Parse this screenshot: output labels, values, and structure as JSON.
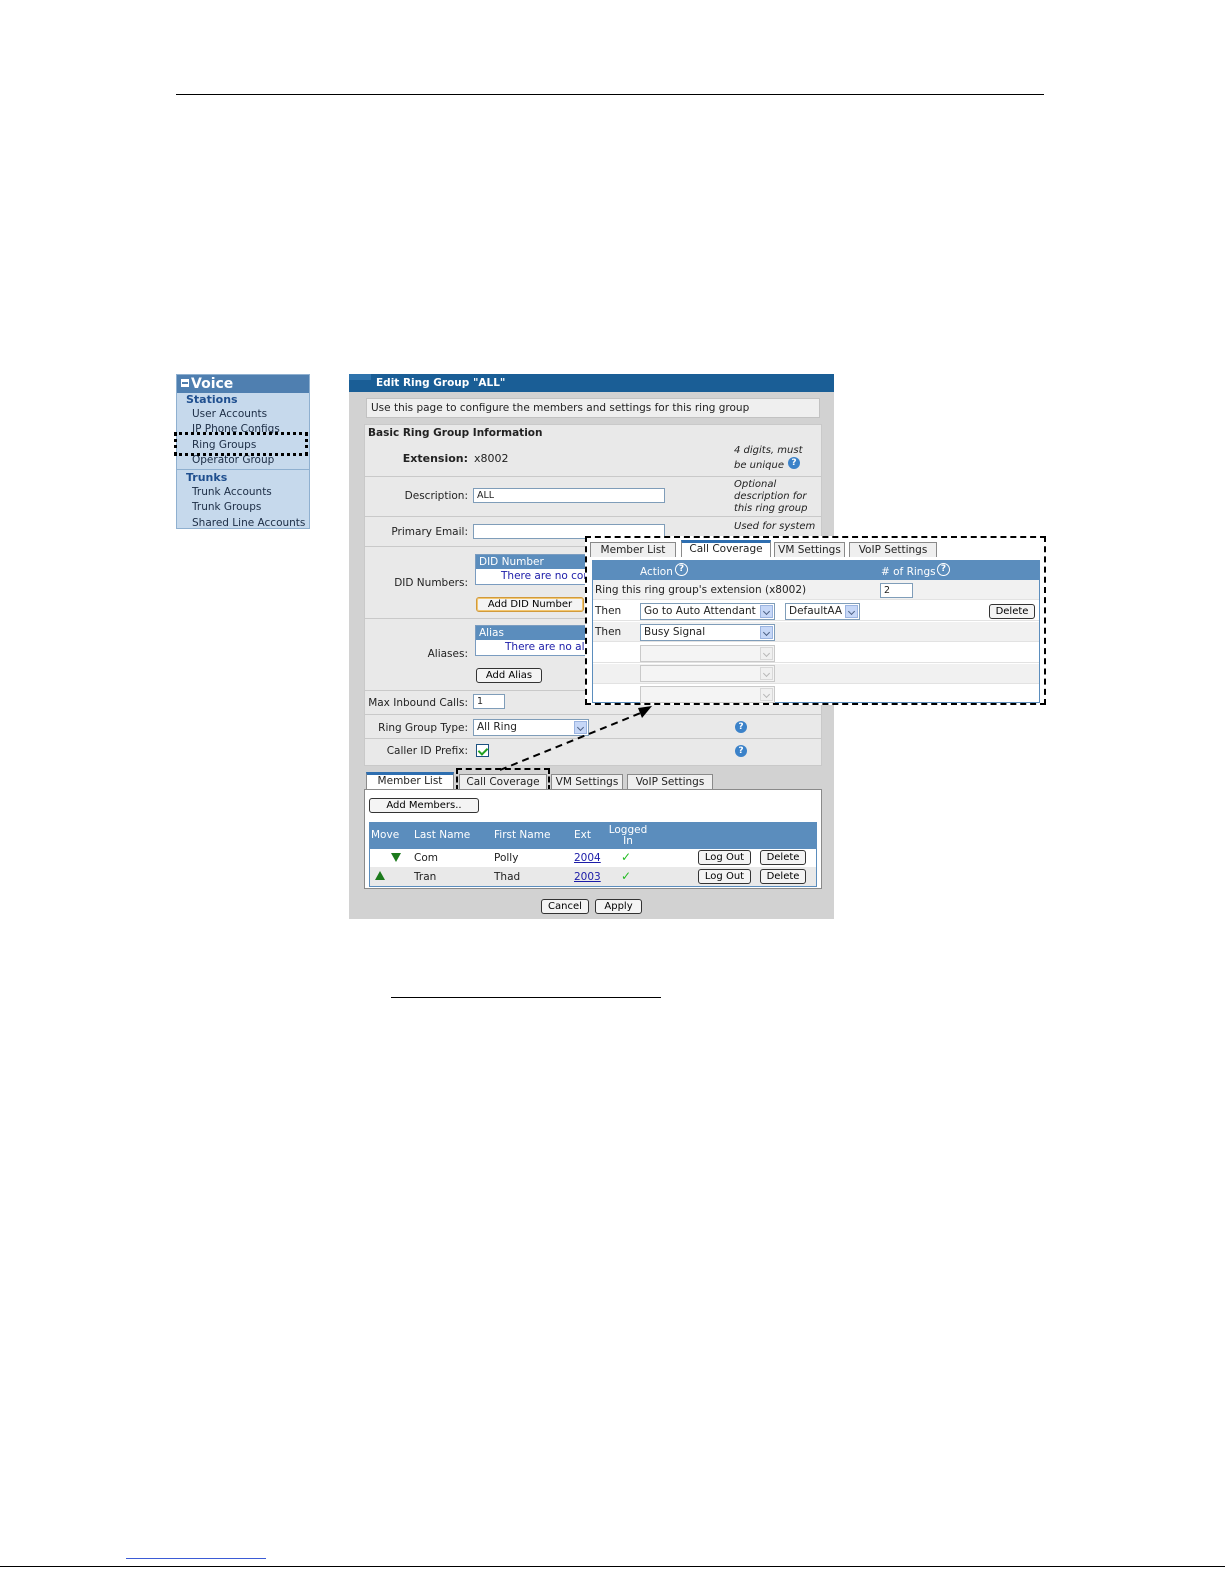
{
  "nav": {
    "header": "Voice",
    "stations_title": "Stations",
    "stations": [
      "User Accounts",
      "IP Phone Configs",
      "Ring Groups",
      "Operator Group"
    ],
    "trunks_title": "Trunks",
    "trunks": [
      "Trunk Accounts",
      "Trunk Groups",
      "Shared Line Accounts"
    ]
  },
  "panel": {
    "title": "Edit Ring Group \"ALL\"",
    "info": "Use this page to configure the members and settings for this ring group",
    "section_title": "Basic Ring Group Information",
    "extension_label": "Extension:",
    "extension_value": "x8002",
    "extension_hint_1": "4 digits, must",
    "extension_hint_2": "be unique",
    "description_label": "Description:",
    "description_value": "ALL",
    "description_hint_1": "Optional",
    "description_hint_2": "description for",
    "description_hint_3": "this ring group",
    "email_label": "Primary Email:",
    "email_value": "",
    "email_hint": "Used for system",
    "did_label": "DID Numbers:",
    "did_header": "DID Number",
    "did_empty": "There are no configured DID numbers",
    "did_button": "Add DID Number",
    "alias_label": "Aliases:",
    "alias_header": "Alias",
    "alias_empty": "There are no aliases configured",
    "alias_button": "Add Alias",
    "max_calls_label": "Max Inbound Calls:",
    "max_calls_value": "1",
    "ring_type_label": "Ring Group Type:",
    "ring_type_value": "All Ring",
    "caller_id_label": "Caller ID Prefix:",
    "caller_id_checked": true,
    "help_glyph": "?"
  },
  "tabs": [
    "Member List",
    "Call Coverage",
    "VM Settings",
    "VoIP Settings"
  ],
  "members": {
    "add_button": "Add Members..",
    "columns": [
      "Move",
      "Last Name",
      "First Name",
      "Ext",
      "Logged In"
    ],
    "rows": [
      {
        "move": "down",
        "last": "Com",
        "first": "Polly",
        "ext": "2004",
        "logged_in": "✓",
        "logout": "Log Out",
        "delete": "Delete"
      },
      {
        "move": "up",
        "last": "Tran",
        "first": "Thad",
        "ext": "2003",
        "logged_in": "✓",
        "logout": "Log Out",
        "delete": "Delete"
      }
    ]
  },
  "footer": {
    "cancel": "Cancel",
    "apply": "Apply"
  },
  "coverage": {
    "action_header": "Action",
    "rings_header": "# of Rings",
    "ring_row": "Ring this ring group's extension (x8002)",
    "rings_value": "2",
    "then_label": "Then",
    "then_1": "Go to Auto Attendant",
    "then_1_target": "DefaultAA",
    "then_1_delete": "Delete",
    "then_2": "Busy Signal"
  },
  "colors": {
    "title_bar": "#1a5e96",
    "grid_header": "#5b8dbd",
    "nav_bg": "#c6d9ec"
  }
}
